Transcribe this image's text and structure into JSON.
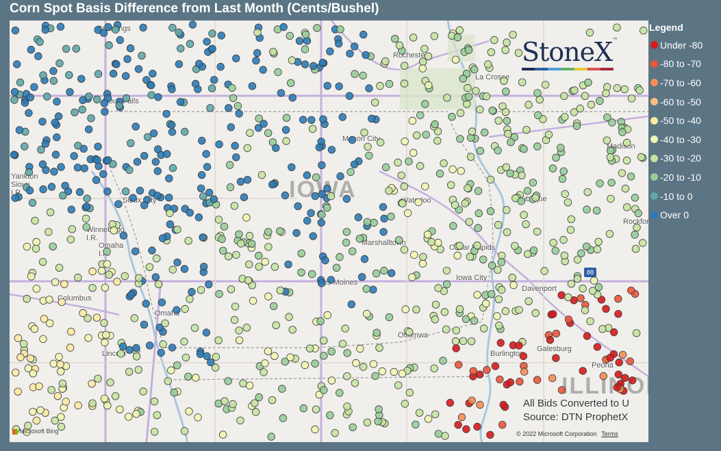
{
  "title": "Corn Spot Basis Difference from Last Month (Cents/Bushel)",
  "legend": {
    "title": "Legend",
    "items": [
      {
        "label": "Under -80",
        "color": "#d7191c"
      },
      {
        "label": "-80 to -70",
        "color": "#e8553b"
      },
      {
        "label": "-70 to -60",
        "color": "#f38d56"
      },
      {
        "label": "-60 to -50",
        "color": "#f9bd7d"
      },
      {
        "label": "-50 to -40",
        "color": "#fde9a3"
      },
      {
        "label": "-40 to -30",
        "color": "#eff5b3"
      },
      {
        "label": "-30 to -20",
        "color": "#c6e3a3"
      },
      {
        "label": "-20 to -10",
        "color": "#98cd9a"
      },
      {
        "label": "-10 to 0",
        "color": "#5fa7a8"
      },
      {
        "label": "Over 0",
        "color": "#2c7bb6"
      }
    ]
  },
  "logo": {
    "text": "StoneX",
    "tm": "™",
    "bar_colors": [
      "#1e3054",
      "#2c5f9e",
      "#4aa0d5",
      "#5fb36e",
      "#e8c53a",
      "#d9534f",
      "#a22b3d"
    ]
  },
  "map": {
    "state_labels": {
      "iowa": "IOWA",
      "illinois": "ILLINOIS"
    },
    "cities": [
      "Brookings",
      "Rochester",
      "La Crosse",
      "Mason City",
      "Madison",
      "Sioux Falls",
      "Sioux City",
      "Waterloo",
      "Dubuque",
      "Winnebago I.R.",
      "Omaha I.R.",
      "Marshalltown",
      "Cedar Rapids",
      "Rockford",
      "Iowa City",
      "Des Moines",
      "Davenport",
      "Columbus",
      "Omaha",
      "Ottumwa",
      "Lincoln",
      "Galesburg",
      "Peoria",
      "Burlington",
      "Yankton Sioux I.R."
    ],
    "interstate_shield": "88"
  },
  "notes": {
    "line1": "All Bids Converted to U",
    "line2": "Source: DTN ProphetX"
  },
  "attribution": {
    "ms_logo": "Microsoft Bing",
    "copyright": "© 2022 Microsoft Corporation",
    "terms": "Terms"
  }
}
